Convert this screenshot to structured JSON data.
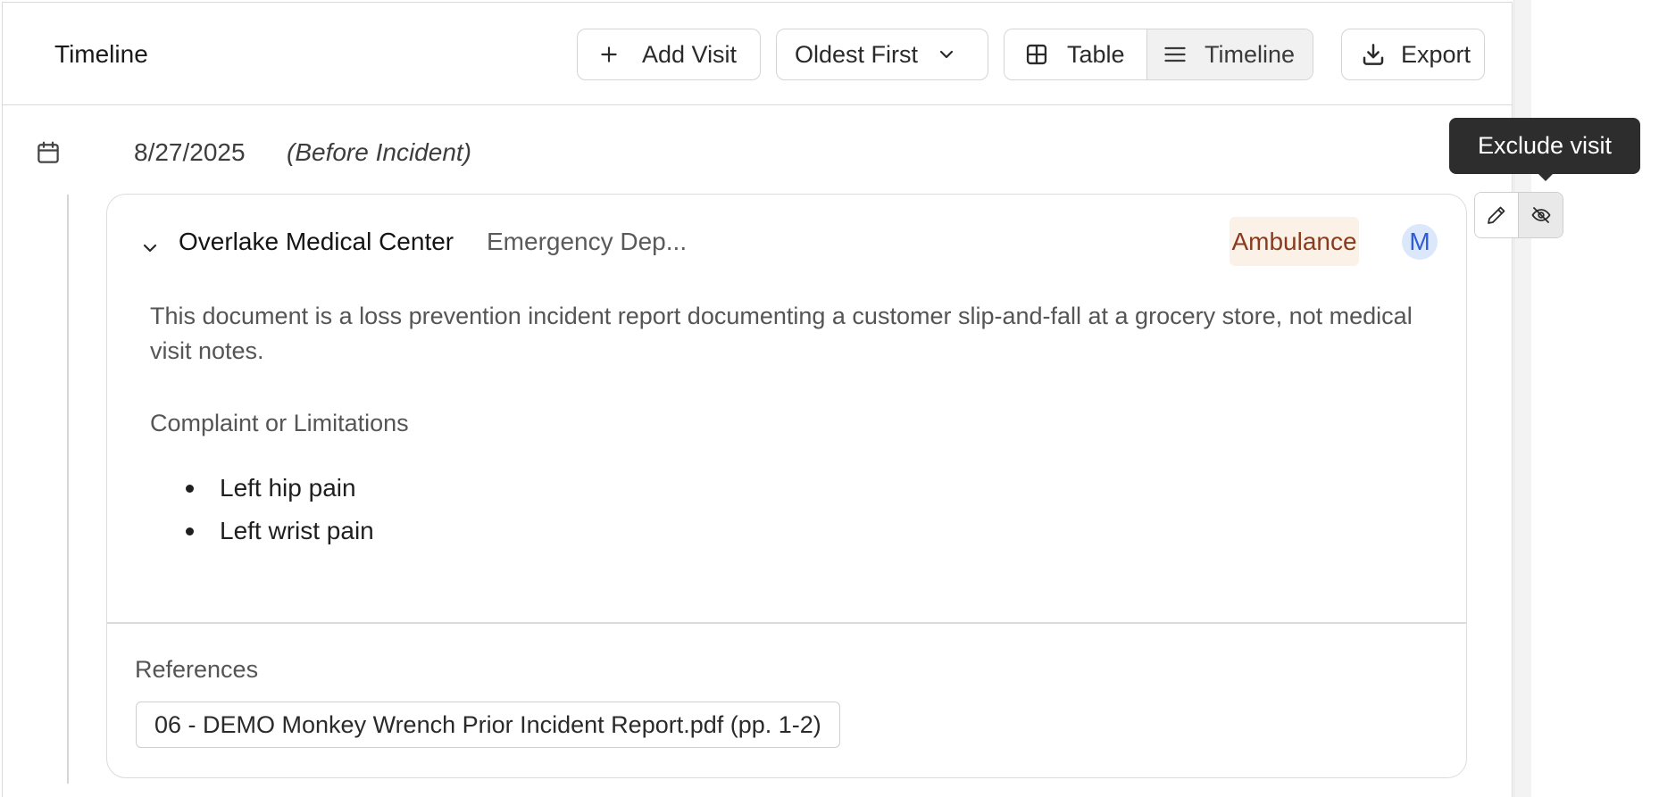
{
  "header": {
    "title": "Timeline",
    "add_visit_label": "Add Visit",
    "sort_label": "Oldest First",
    "view_table_label": "Table",
    "view_timeline_label": "Timeline",
    "export_label": "Export",
    "active_view": "Timeline"
  },
  "entry": {
    "date": "8/27/2025",
    "date_note": "(Before Incident)",
    "provider": "Overlake Medical Center",
    "department": "Emergency Dep...",
    "badge": "Ambulance",
    "avatar_initial": "M",
    "summary": "This document is a loss prevention incident report documenting a customer slip-and-fall at a grocery store, not medical visit notes.",
    "complaint_heading": "Complaint or Limitations",
    "complaints": [
      "Left hip pain",
      "Left wrist pain"
    ],
    "references_heading": "References",
    "reference": "06 - DEMO Monkey Wrench Prior Incident Report.pdf (pp. 1-2)"
  },
  "tooltip": {
    "text": "Exclude visit"
  },
  "icons": {
    "add": "plus-icon",
    "sort": "chevron-down-icon",
    "table": "grid-icon",
    "timeline": "list-icon",
    "export": "download-icon",
    "date": "calendar-icon",
    "collapse": "chevron-down-icon",
    "edit": "pencil-icon",
    "exclude": "eye-off-icon"
  },
  "colors": {
    "badge_bg": "#fbf1e6",
    "badge_text": "#8a3b1e",
    "avatar_bg": "#dbe7fb",
    "avatar_text": "#2f5bd8",
    "tooltip_bg": "#2d2d2d"
  }
}
